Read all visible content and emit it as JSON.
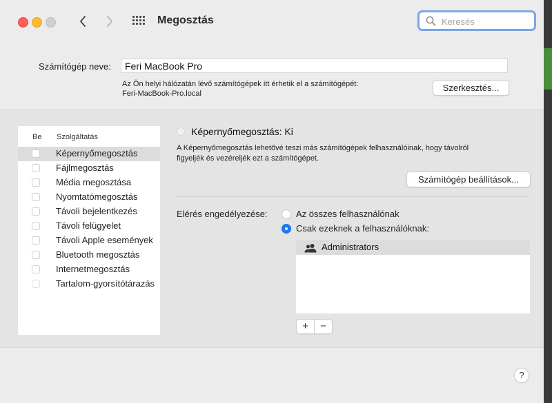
{
  "window": {
    "title": "Megosztás"
  },
  "search": {
    "placeholder": "Keresés",
    "value": ""
  },
  "computer": {
    "name_label": "Számítógép neve:",
    "name_value": "Feri MacBook Pro",
    "description_line1": "Az Ön helyi hálózatán lévő számítógépek itt érhetik el a számítógépét:",
    "description_line2": "Feri-MacBook-Pro.local",
    "edit_button": "Szerkesztés..."
  },
  "services": {
    "header_on": "Be",
    "header_service": "Szolgáltatás",
    "items": [
      {
        "label": "Képernyőmegosztás",
        "checked": false,
        "selected": true
      },
      {
        "label": "Fájlmegosztás",
        "checked": false,
        "selected": false
      },
      {
        "label": "Média megosztása",
        "checked": false,
        "selected": false
      },
      {
        "label": "Nyomtatómegosztás",
        "checked": false,
        "selected": false
      },
      {
        "label": "Távoli bejelentkezés",
        "checked": false,
        "selected": false
      },
      {
        "label": "Távoli felügyelet",
        "checked": false,
        "selected": false
      },
      {
        "label": "Távoli Apple események",
        "checked": false,
        "selected": false
      },
      {
        "label": "Bluetooth megosztás",
        "checked": false,
        "selected": false
      },
      {
        "label": "Internetmegosztás",
        "checked": false,
        "selected": false
      },
      {
        "label": "Tartalom-gyorsítótárazás",
        "checked": false,
        "selected": false
      }
    ]
  },
  "detail": {
    "status": "Képernyőmegosztás: Ki",
    "description_line1": "A Képernyőmegosztás lehetővé teszi más számítógépek felhasználóinak, hogy távolról",
    "description_line2": "figyeljék és vezéreljék ezt a számítógépet.",
    "settings_button": "Számítógép beállítások...",
    "access_label": "Elérés engedélyezése:",
    "option_all": "Az összes felhasználónak",
    "option_only": "Csak ezeknek a felhasználóknak:",
    "selected_option": "only",
    "users": [
      "Administrators"
    ],
    "add_label": "+",
    "remove_label": "−"
  },
  "help": {
    "label": "?"
  },
  "icons": {
    "back": "chevron-left-icon",
    "forward": "chevron-right-icon",
    "grid": "grid-icon",
    "search": "magnifier-icon",
    "group": "users-group-icon"
  }
}
